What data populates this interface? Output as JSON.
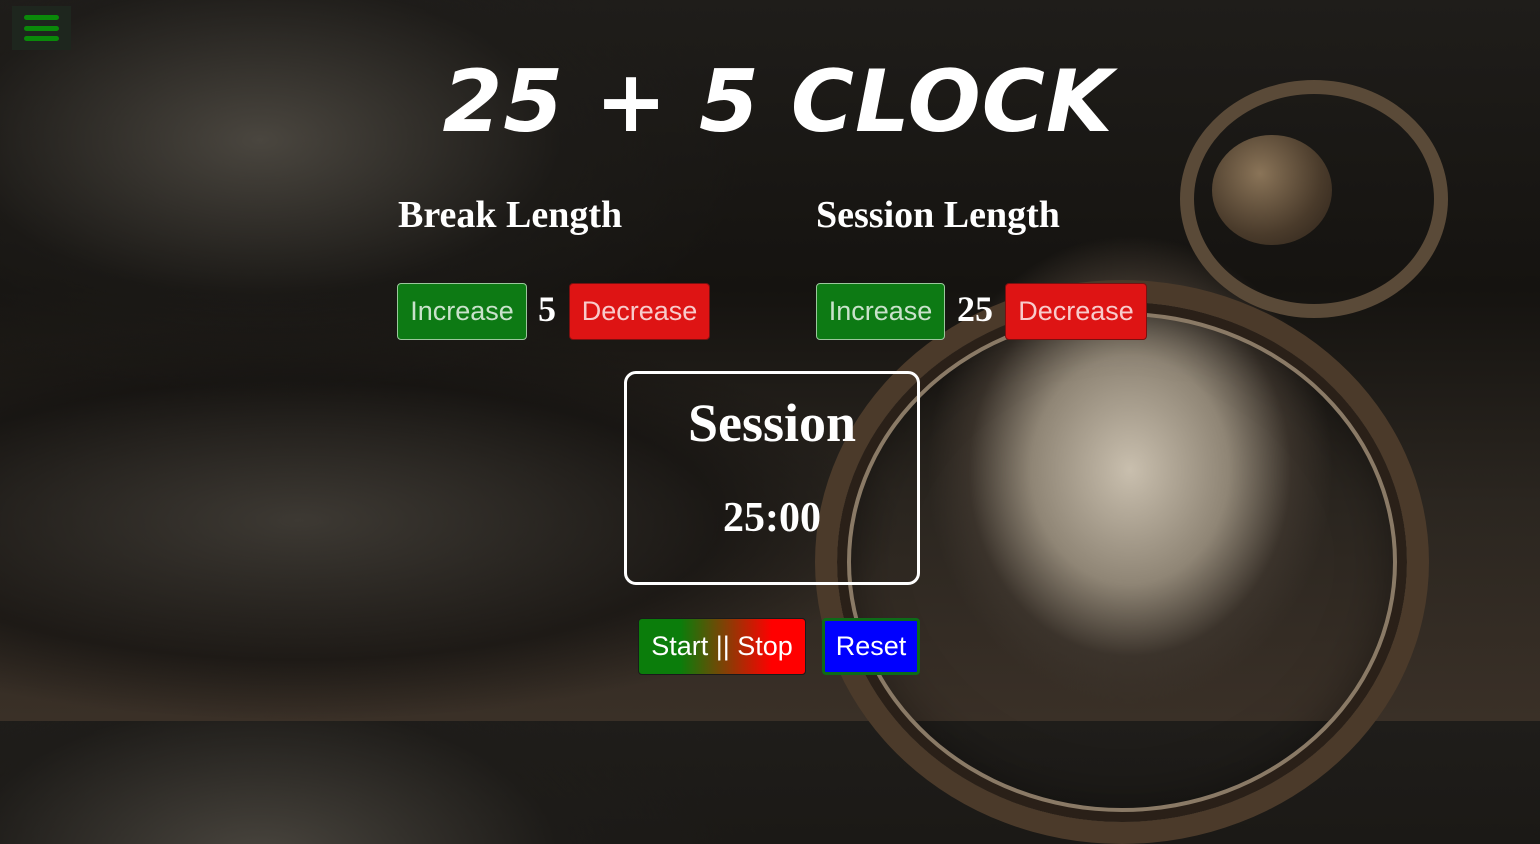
{
  "menu": {
    "icon": "hamburger-menu-icon",
    "color": "#0a8a0a"
  },
  "title": "25 + 5 CLOCK",
  "break": {
    "label": "Break Length",
    "increase_label": "Increase",
    "value": "5",
    "decrease_label": "Decrease"
  },
  "session": {
    "label": "Session Length",
    "increase_label": "Increase",
    "value": "25",
    "decrease_label": "Decrease"
  },
  "timer": {
    "label": "Session",
    "time": "25:00"
  },
  "controls": {
    "start_stop_label": "Start || Stop",
    "reset_label": "Reset"
  },
  "colors": {
    "increase": "#0d7a14",
    "decrease": "#de1414",
    "reset": "#0000ff"
  }
}
